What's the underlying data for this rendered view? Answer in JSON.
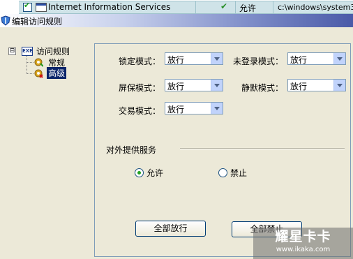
{
  "service_list": {
    "name": "Internet Information Services",
    "status": "允许",
    "path": "c:\\windows\\system3"
  },
  "window": {
    "title": "编辑访问规则"
  },
  "tree": {
    "root_label": "访问规则",
    "root_icon_text": "EXE",
    "expander": "⊟",
    "items": [
      {
        "label": "常规"
      },
      {
        "label": "高级"
      }
    ]
  },
  "settings": {
    "lock_mode": {
      "label": "锁定模式：",
      "value": "放行"
    },
    "not_logged_in_mode": {
      "label": "未登录模式：",
      "value": "放行"
    },
    "screensaver_mode": {
      "label": "屏保模式：",
      "value": "放行"
    },
    "silent_mode": {
      "label": "静默模式：",
      "value": "放行"
    },
    "trade_mode": {
      "label": "交易模式：",
      "value": "放行"
    }
  },
  "external_service": {
    "group_label": "对外提供服务",
    "allow_label": "允许",
    "deny_label": "禁止",
    "selected": "allow"
  },
  "buttons": {
    "allow_all": "全部放行",
    "deny_all": "全部禁止"
  },
  "watermark": {
    "big": "耀星卡卡",
    "small": "www.ikaka.com"
  }
}
